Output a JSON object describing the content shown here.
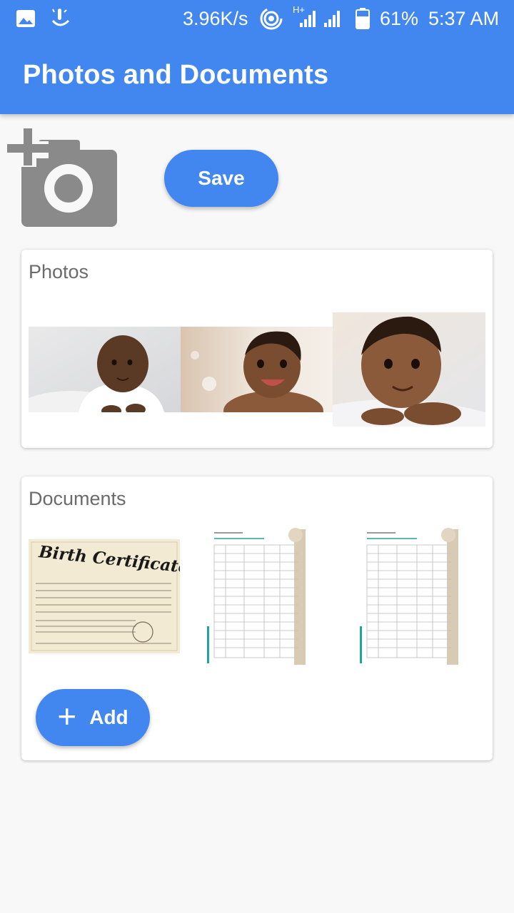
{
  "status_bar": {
    "network_speed": "3.96K/s",
    "network_type": "H+",
    "battery": "61%",
    "time": "5:37 AM",
    "icons": [
      "image-icon",
      "touchpal-keyboard-icon",
      "hotspot-icon",
      "signal-icon",
      "battery-icon"
    ]
  },
  "app_bar": {
    "title": "Photos and Documents",
    "color": "#4287f0"
  },
  "toolbar": {
    "add_photo_icon": "add-a-photo-icon",
    "save_label": "Save"
  },
  "photos": {
    "title": "Photos",
    "items": [
      "baby-photo-1",
      "baby-photo-2",
      "baby-photo-3"
    ]
  },
  "documents": {
    "title": "Documents",
    "birth_certificate_heading": "Birth Certificate",
    "items": [
      "birth-certificate",
      "form-document-1",
      "form-document-2"
    ],
    "add_label": "Add"
  }
}
